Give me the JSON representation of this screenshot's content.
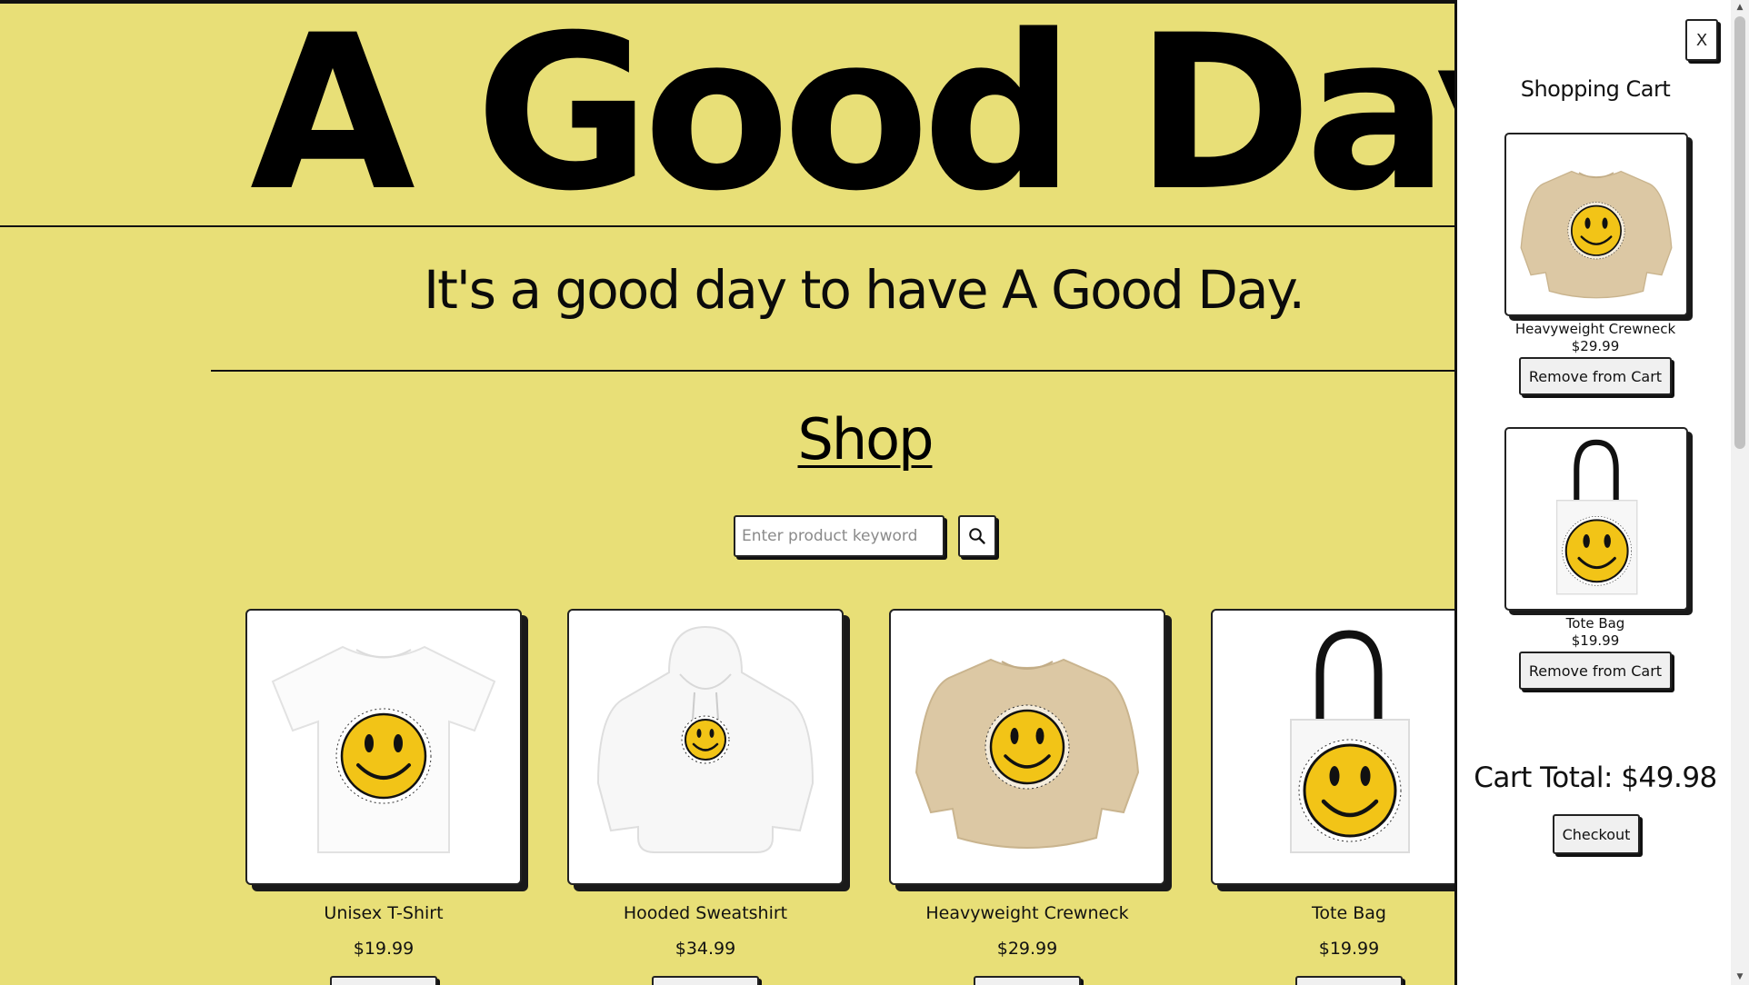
{
  "header": {
    "brand": "A Good Day Co.",
    "tagline": "It's a good day to have A Good Day."
  },
  "shop": {
    "title": "Shop",
    "search_placeholder": "Enter product keyword",
    "search_icon": "magnifying-glass-icon",
    "products": [
      {
        "name": "Unisex T-Shirt",
        "price": "$19.99",
        "icon": "t-shirt-smiley-image"
      },
      {
        "name": "Hooded Sweatshirt",
        "price": "$34.99",
        "icon": "hoodie-smiley-image"
      },
      {
        "name": "Heavyweight Crewneck",
        "price": "$29.99",
        "icon": "crewneck-smiley-image"
      },
      {
        "name": "Tote Bag",
        "price": "$19.99",
        "icon": "tote-bag-smiley-image"
      }
    ]
  },
  "cart": {
    "close_label": "X",
    "title": "Shopping Cart",
    "items": [
      {
        "name": "Heavyweight Crewneck",
        "price": "$29.99",
        "remove_label": "Remove from Cart"
      },
      {
        "name": "Tote Bag",
        "price": "$19.99",
        "remove_label": "Remove from Cart"
      }
    ],
    "total_label": "Cart Total: $49.98",
    "checkout_label": "Checkout"
  },
  "colors": {
    "page_background": "#e8df77",
    "smiley_yellow": "#f2c417",
    "crewneck_tan": "#dcc8a4",
    "text": "#0b0b0b"
  }
}
